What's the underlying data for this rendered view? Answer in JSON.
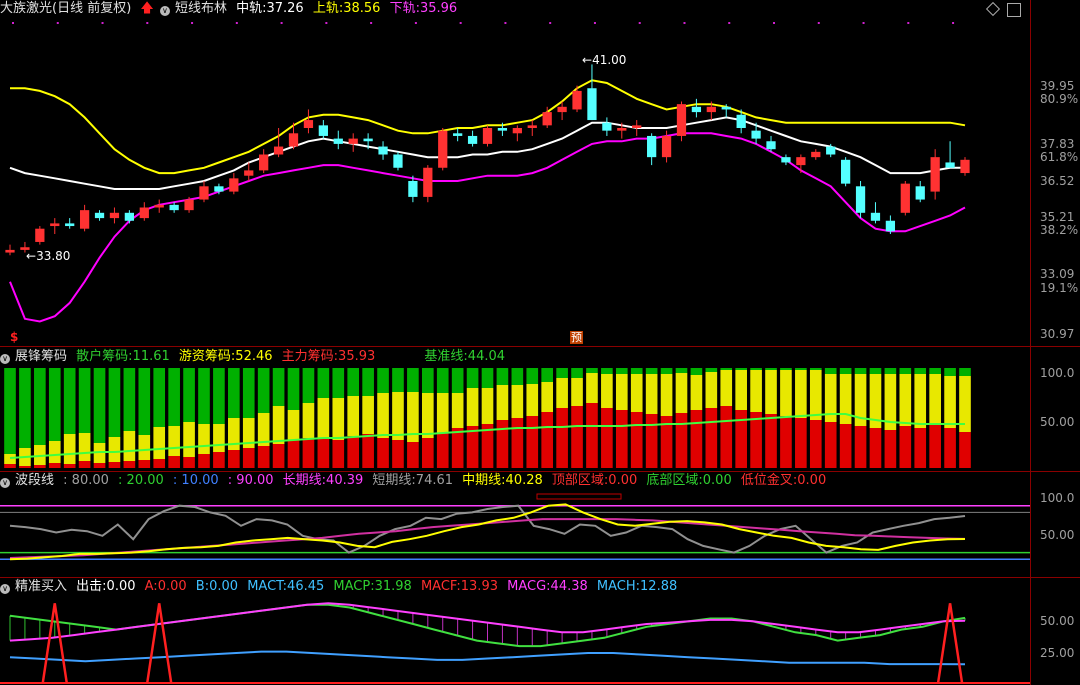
{
  "main": {
    "title": "大族激光(日线 前复权)",
    "indicator": "短线布林",
    "mid_label": "中轨:",
    "mid_val": "37.26",
    "up_label": "上轨:",
    "up_val": "38.56",
    "dn_label": "下轨:",
    "dn_val": "35.96",
    "high_note": "41.00",
    "low_note": "33.80",
    "marker_s": "$",
    "marker_yu": "预",
    "axis": [
      "39.95",
      "80.9%",
      "37.83",
      "61.8%",
      "36.52",
      "35.21",
      "38.2%",
      "33.09",
      "19.1%",
      "30.97"
    ]
  },
  "chips": {
    "title": "展锋筹码",
    "retail_label": "散户筹码:",
    "retail_val": "11.61",
    "hot_label": "游资筹码:",
    "hot_val": "52.46",
    "main_label": "主力筹码:",
    "main_val": "35.93",
    "base_label": "基准线:",
    "base_val": "44.04",
    "axis": [
      "100.0",
      "50.00"
    ]
  },
  "wave": {
    "title": "波段线",
    "l80": ": 80.00",
    "l20": ": 20.00",
    "l10": ": 10.00",
    "l90": ": 90.00",
    "long_label": "长期线:",
    "long_val": "40.39",
    "short_label": "短期线:",
    "short_val": "74.61",
    "mid_label": "中期线:",
    "mid_val": "40.28",
    "top_label": "顶部区域:",
    "top_val": "0.00",
    "bot_label": "底部区域:",
    "bot_val": "0.00",
    "cross_label": "低位金叉:",
    "cross_val": "0.00",
    "axis": [
      "100.0",
      "50.00"
    ]
  },
  "buy": {
    "title": "精准买入",
    "out_label": "出击:",
    "out_val": "0.00",
    "a_label": "A:",
    "a_val": "0.00",
    "b_label": "B:",
    "b_val": "0.00",
    "mact_label": "MACT:",
    "mact_val": "46.45",
    "macp_label": "MACP:",
    "macp_val": "31.98",
    "macf_label": "MACF:",
    "macf_val": "13.93",
    "macg_label": "MACG:",
    "macg_val": "44.38",
    "mach_label": "MACH:",
    "mach_val": "12.88",
    "axis": [
      "50.00",
      "25.00"
    ]
  },
  "colors": {
    "up": "#ff3232",
    "down": "#54ffff",
    "upper_band": "#ffff00",
    "lower_band": "#ff00ff",
    "mid_band": "#ffffff"
  },
  "candles": [
    [
      33.9,
      34.2,
      33.8,
      34.0
    ],
    [
      34.0,
      34.3,
      33.9,
      34.1
    ],
    [
      34.3,
      34.9,
      34.2,
      34.8
    ],
    [
      34.9,
      35.2,
      34.6,
      35.0
    ],
    [
      35.0,
      35.2,
      34.8,
      34.9
    ],
    [
      34.8,
      35.7,
      34.7,
      35.5
    ],
    [
      35.4,
      35.5,
      35.1,
      35.2
    ],
    [
      35.2,
      35.6,
      35.0,
      35.4
    ],
    [
      35.4,
      35.5,
      35.0,
      35.1
    ],
    [
      35.2,
      35.8,
      35.1,
      35.6
    ],
    [
      35.6,
      35.9,
      35.4,
      35.7
    ],
    [
      35.7,
      35.8,
      35.4,
      35.5
    ],
    [
      35.5,
      36.0,
      35.4,
      35.9
    ],
    [
      35.9,
      36.6,
      35.8,
      36.4
    ],
    [
      36.4,
      36.5,
      36.1,
      36.2
    ],
    [
      36.2,
      36.9,
      36.1,
      36.7
    ],
    [
      36.8,
      37.3,
      36.6,
      37.0
    ],
    [
      37.0,
      37.8,
      36.9,
      37.6
    ],
    [
      37.6,
      38.6,
      37.5,
      37.9
    ],
    [
      37.9,
      38.8,
      37.8,
      38.4
    ],
    [
      38.6,
      39.3,
      38.4,
      38.9
    ],
    [
      38.7,
      38.9,
      38.2,
      38.3
    ],
    [
      38.2,
      38.5,
      37.8,
      38.0
    ],
    [
      38.0,
      38.4,
      37.7,
      38.2
    ],
    [
      38.2,
      38.4,
      37.8,
      38.1
    ],
    [
      37.9,
      38.1,
      37.4,
      37.6
    ],
    [
      37.6,
      37.7,
      37.0,
      37.1
    ],
    [
      36.6,
      36.8,
      35.8,
      36.0
    ],
    [
      36.0,
      37.2,
      35.8,
      37.1
    ],
    [
      37.1,
      38.6,
      37.0,
      38.5
    ],
    [
      38.4,
      38.6,
      38.1,
      38.3
    ],
    [
      38.3,
      38.5,
      37.9,
      38.0
    ],
    [
      38.0,
      38.7,
      37.9,
      38.6
    ],
    [
      38.6,
      38.8,
      38.3,
      38.5
    ],
    [
      38.4,
      38.7,
      38.1,
      38.6
    ],
    [
      38.6,
      38.9,
      38.3,
      38.7
    ],
    [
      38.7,
      39.4,
      38.6,
      39.2
    ],
    [
      39.2,
      39.6,
      38.9,
      39.4
    ],
    [
      39.3,
      40.2,
      39.2,
      40.0
    ],
    [
      40.1,
      41.0,
      38.9,
      38.9
    ],
    [
      38.8,
      39.0,
      38.3,
      38.5
    ],
    [
      38.5,
      38.8,
      38.2,
      38.6
    ],
    [
      38.6,
      38.9,
      38.3,
      38.7
    ],
    [
      38.3,
      38.4,
      37.2,
      37.5
    ],
    [
      37.5,
      38.5,
      37.3,
      38.3
    ],
    [
      38.3,
      39.6,
      38.1,
      39.5
    ],
    [
      39.4,
      39.7,
      39.0,
      39.2
    ],
    [
      39.2,
      39.6,
      38.9,
      39.4
    ],
    [
      39.4,
      39.5,
      39.0,
      39.3
    ],
    [
      39.1,
      39.3,
      38.4,
      38.6
    ],
    [
      38.5,
      38.8,
      38.0,
      38.2
    ],
    [
      38.1,
      38.3,
      37.7,
      37.8
    ],
    [
      37.5,
      37.6,
      37.2,
      37.3
    ],
    [
      37.2,
      37.6,
      36.9,
      37.5
    ],
    [
      37.5,
      37.8,
      37.4,
      37.7
    ],
    [
      37.9,
      38.0,
      37.5,
      37.6
    ],
    [
      37.4,
      37.5,
      36.4,
      36.5
    ],
    [
      36.4,
      36.6,
      35.2,
      35.4
    ],
    [
      35.4,
      35.8,
      35.0,
      35.1
    ],
    [
      35.1,
      35.3,
      34.6,
      34.7
    ],
    [
      35.4,
      36.6,
      35.3,
      36.5
    ],
    [
      36.4,
      36.6,
      35.8,
      35.9
    ],
    [
      36.2,
      37.8,
      35.9,
      37.5
    ],
    [
      37.3,
      38.1,
      37.2,
      37.1
    ],
    [
      36.9,
      37.5,
      36.8,
      37.4
    ]
  ],
  "bands": {
    "upper": [
      40.1,
      40.1,
      40.0,
      39.8,
      39.5,
      39.0,
      38.4,
      37.8,
      37.4,
      37.1,
      36.9,
      36.9,
      37.0,
      37.1,
      37.3,
      37.5,
      37.7,
      38.0,
      38.3,
      38.7,
      39.0,
      39.1,
      39.1,
      39.0,
      38.9,
      38.7,
      38.5,
      38.4,
      38.4,
      38.5,
      38.6,
      38.6,
      38.7,
      38.7,
      38.8,
      38.9,
      39.2,
      39.6,
      40.1,
      40.4,
      40.3,
      40.0,
      39.7,
      39.5,
      39.3,
      39.4,
      39.5,
      39.5,
      39.4,
      39.2,
      39.0,
      38.9,
      38.8,
      38.8,
      38.8,
      38.8,
      38.8,
      38.8,
      38.8,
      38.8,
      38.8,
      38.8,
      38.8,
      38.8,
      38.7
    ],
    "mid": [
      37.1,
      36.9,
      36.8,
      36.7,
      36.6,
      36.5,
      36.4,
      36.3,
      36.3,
      36.3,
      36.3,
      36.4,
      36.5,
      36.6,
      36.8,
      37.0,
      37.3,
      37.5,
      37.7,
      37.9,
      38.1,
      38.2,
      38.1,
      38.0,
      37.9,
      37.8,
      37.7,
      37.6,
      37.5,
      37.5,
      37.5,
      37.6,
      37.6,
      37.7,
      37.7,
      37.8,
      38.0,
      38.2,
      38.5,
      38.8,
      38.8,
      38.7,
      38.6,
      38.6,
      38.6,
      38.7,
      38.8,
      38.9,
      39.0,
      38.9,
      38.7,
      38.5,
      38.3,
      38.1,
      38.0,
      37.9,
      37.7,
      37.5,
      37.2,
      36.9,
      36.9,
      36.9,
      37.0,
      37.1,
      37.1
    ],
    "lower": [
      32.8,
      31.4,
      31.3,
      31.5,
      32.0,
      32.8,
      33.7,
      34.5,
      35.1,
      35.5,
      35.7,
      35.8,
      35.9,
      36.0,
      36.2,
      36.4,
      36.6,
      36.8,
      36.9,
      37.0,
      37.1,
      37.2,
      37.2,
      37.1,
      37.0,
      36.9,
      36.8,
      36.7,
      36.6,
      36.6,
      36.6,
      36.7,
      36.8,
      36.8,
      36.8,
      36.9,
      37.1,
      37.4,
      37.7,
      38.0,
      38.1,
      38.1,
      38.2,
      38.2,
      38.3,
      38.4,
      38.4,
      38.4,
      38.3,
      38.2,
      38.0,
      37.7,
      37.4,
      37.0,
      36.7,
      36.4,
      35.8,
      35.2,
      34.8,
      34.7,
      34.7,
      34.9,
      35.1,
      35.3,
      35.6
    ]
  },
  "chip_bars": {
    "red": [
      4,
      2,
      3,
      5,
      4,
      7,
      5,
      6,
      7,
      8,
      9,
      12,
      11,
      14,
      16,
      18,
      20,
      22,
      24,
      28,
      30,
      30,
      28,
      32,
      34,
      30,
      28,
      26,
      30,
      35,
      40,
      42,
      44,
      48,
      50,
      52,
      56,
      60,
      62,
      65,
      60,
      58,
      56,
      54,
      52,
      55,
      58,
      60,
      62,
      58,
      56,
      54,
      52,
      50,
      48,
      46,
      44,
      42,
      40,
      38,
      42,
      40,
      44,
      40,
      36
    ],
    "yellow": [
      10,
      18,
      20,
      22,
      30,
      28,
      20,
      25,
      30,
      25,
      32,
      30,
      35,
      30,
      28,
      32,
      30,
      33,
      38,
      30,
      35,
      40,
      42,
      40,
      38,
      45,
      48,
      50,
      45,
      40,
      35,
      38,
      36,
      35,
      33,
      32,
      30,
      30,
      28,
      30,
      34,
      36,
      38,
      40,
      42,
      40,
      35,
      36,
      36,
      40,
      42,
      44,
      46,
      48,
      50,
      48,
      50,
      52,
      54,
      56,
      52,
      54,
      50,
      52,
      56
    ],
    "base": [
      10,
      11,
      12,
      13,
      14,
      15,
      16,
      16,
      17,
      18,
      19,
      20,
      21,
      22,
      23,
      24,
      25,
      26,
      27,
      28,
      29,
      30,
      30,
      31,
      32,
      33,
      33,
      34,
      34,
      35,
      36,
      37,
      38,
      39,
      40,
      40,
      41,
      41,
      42,
      42,
      42,
      42,
      43,
      43,
      44,
      44,
      45,
      46,
      47,
      48,
      49,
      50,
      51,
      52,
      53,
      54,
      54,
      50,
      48,
      46,
      45,
      44,
      44,
      44,
      44
    ]
  },
  "wave_lines": {
    "short": [
      60,
      58,
      55,
      50,
      54,
      52,
      45,
      62,
      40,
      70,
      82,
      90,
      88,
      80,
      75,
      60,
      70,
      68,
      62,
      45,
      40,
      38,
      20,
      30,
      45,
      55,
      60,
      72,
      70,
      78,
      80,
      85,
      88,
      90,
      60,
      55,
      48,
      62,
      60,
      45,
      50,
      60,
      58,
      55,
      40,
      30,
      25,
      20,
      30,
      45,
      55,
      60,
      40,
      20,
      30,
      35,
      50,
      55,
      60,
      64,
      70,
      72,
      74.61
    ],
    "mid": [
      10,
      11,
      13,
      15,
      18,
      18,
      19,
      20,
      22,
      25,
      27,
      28,
      30,
      35,
      38,
      40,
      42,
      40,
      38,
      35,
      30,
      28,
      36,
      40,
      45,
      52,
      58,
      62,
      68,
      72,
      80,
      90,
      92,
      80,
      70,
      62,
      60,
      63,
      66,
      67,
      65,
      62,
      55,
      50,
      45,
      42,
      35,
      30,
      28,
      25,
      24,
      30,
      35,
      38,
      40,
      40.28
    ],
    "long": [
      12,
      13,
      14,
      15,
      16,
      18,
      20,
      22,
      24,
      26,
      28,
      30,
      32,
      34,
      36,
      38,
      40,
      42,
      45,
      48,
      50,
      52,
      55,
      58,
      60,
      62,
      64,
      66,
      68,
      70,
      70,
      70,
      70,
      70,
      69,
      68,
      66,
      64,
      62,
      60,
      58,
      56,
      54,
      52,
      50,
      48,
      46,
      45,
      44,
      43,
      42,
      41,
      40.39
    ]
  },
  "buy_lines": {
    "green": [
      48,
      46,
      44,
      42,
      40,
      38,
      40,
      42,
      44,
      46,
      48,
      50,
      52,
      54,
      56,
      56,
      54,
      50,
      46,
      42,
      38,
      34,
      30,
      28,
      26,
      26,
      28,
      30,
      32,
      36,
      40,
      42,
      44,
      46,
      46,
      44,
      40,
      36,
      34,
      30,
      32,
      34,
      38,
      40,
      44,
      46.45
    ],
    "purple": [
      30,
      31,
      32,
      34,
      36,
      38,
      40,
      42,
      44,
      46,
      48,
      50,
      52,
      54,
      56,
      57,
      56,
      54,
      52,
      50,
      48,
      46,
      44,
      42,
      40,
      38,
      36,
      36,
      38,
      40,
      42,
      43,
      44,
      45,
      45,
      44,
      42,
      40,
      38,
      36,
      36,
      38,
      40,
      42,
      44,
      44.38
    ],
    "blue": [
      18,
      17,
      16,
      15,
      16,
      17,
      18,
      19,
      20,
      21,
      22,
      22,
      21,
      20,
      19,
      18,
      17,
      16,
      16,
      17,
      18,
      19,
      20,
      21,
      21,
      20,
      19,
      18,
      17,
      16,
      15,
      14,
      14,
      14,
      14,
      13,
      13,
      13,
      12.88
    ],
    "red_spikes": [
      3,
      10,
      63
    ]
  }
}
